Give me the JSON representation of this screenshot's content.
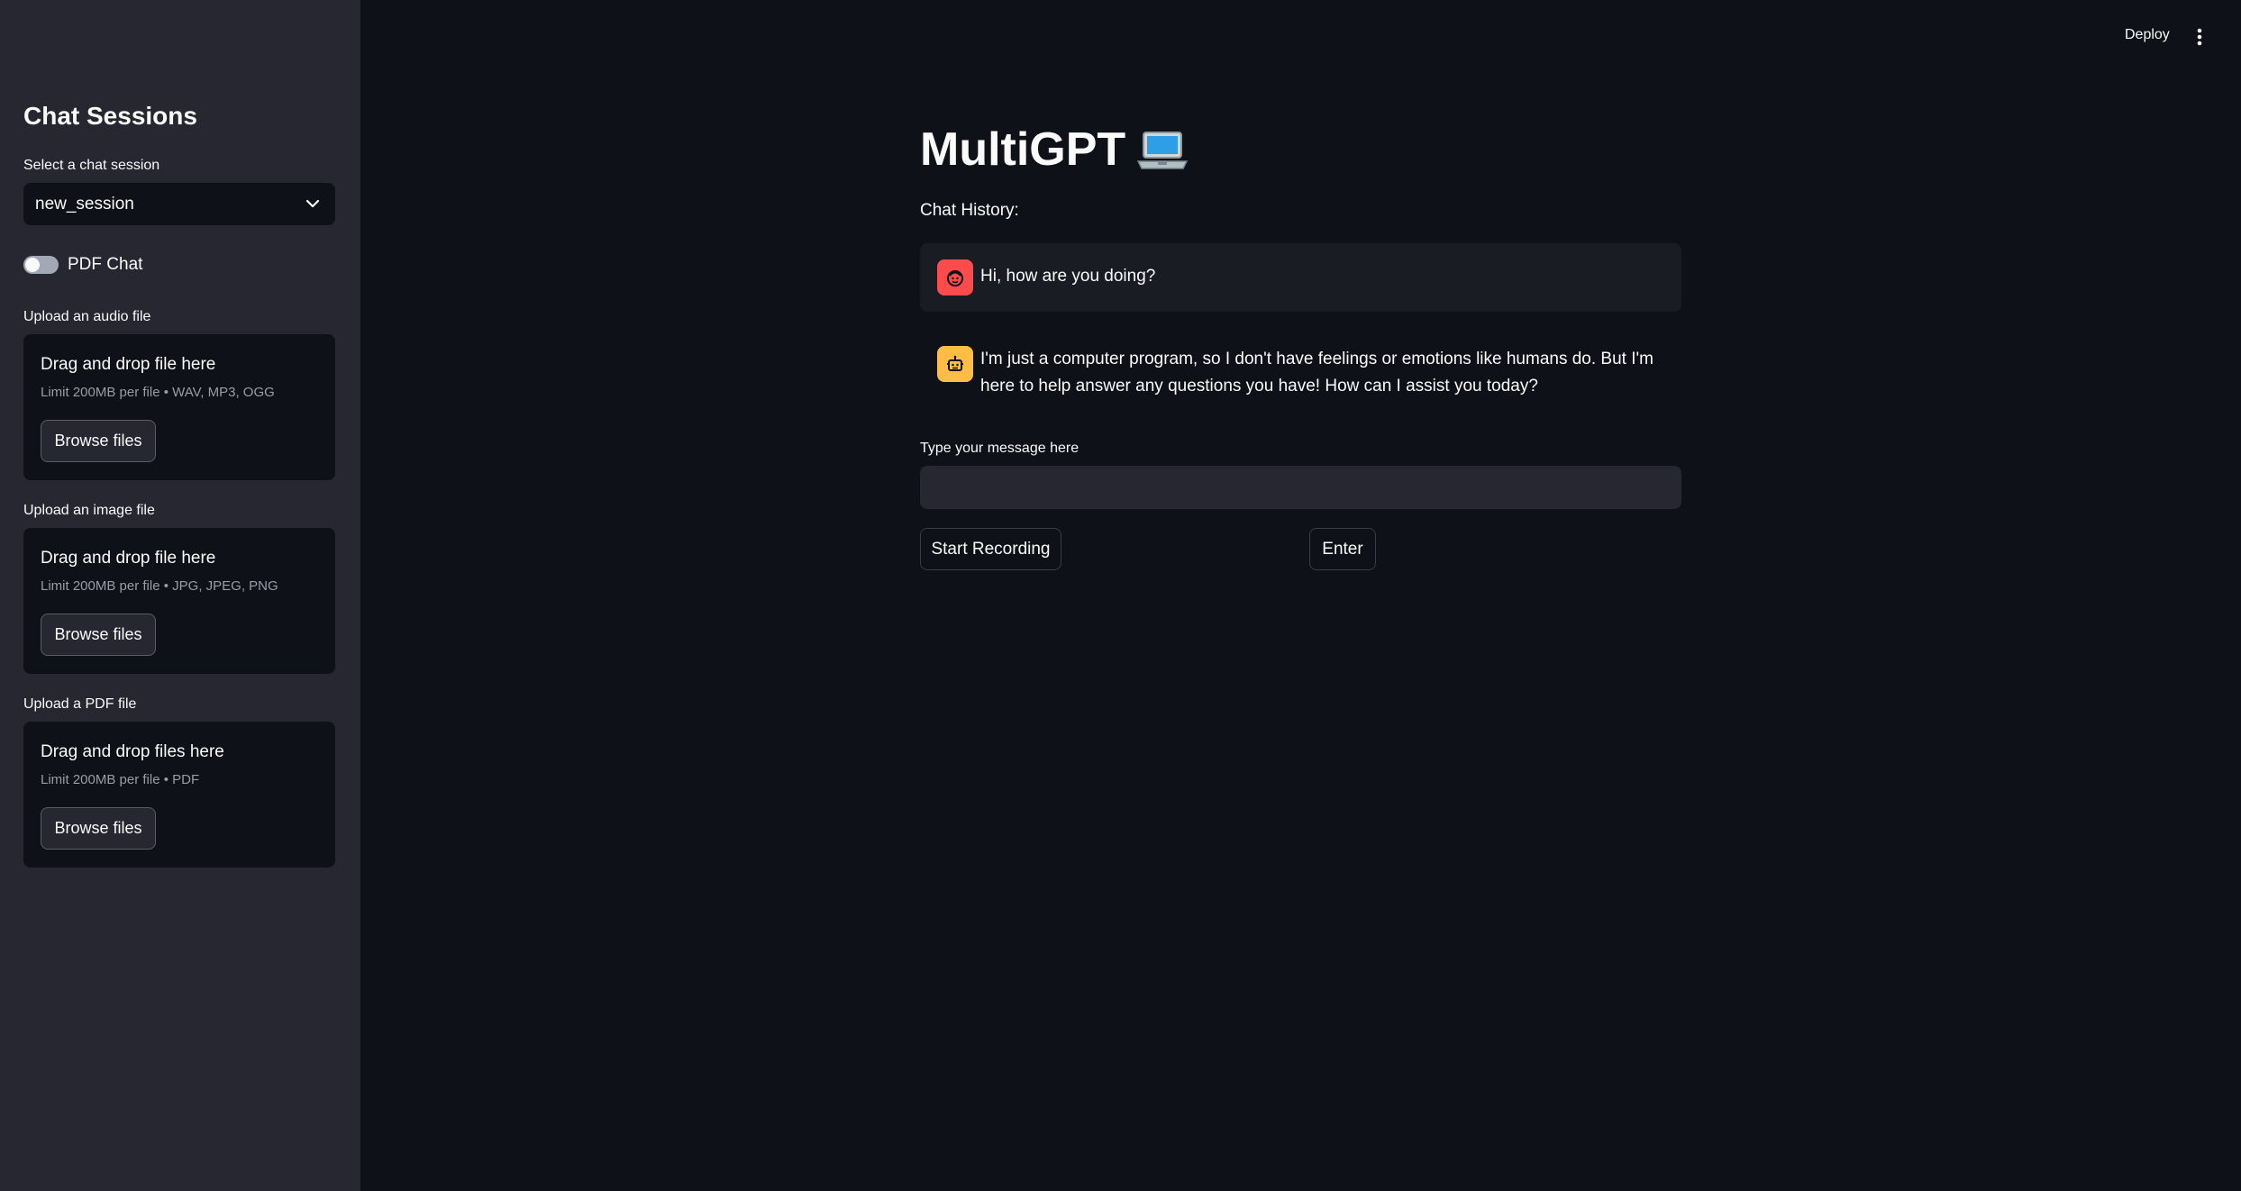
{
  "sidebar": {
    "title": "Chat Sessions",
    "session_select": {
      "label": "Select a chat session",
      "value": "new_session"
    },
    "pdf_toggle": {
      "label": "PDF Chat",
      "checked": false
    },
    "uploaders": [
      {
        "label": "Upload an audio file",
        "drop_text": "Drag and drop file here",
        "limit": "Limit 200MB per file • WAV, MP3, OGG",
        "button": "Browse files"
      },
      {
        "label": "Upload an image file",
        "drop_text": "Drag and drop file here",
        "limit": "Limit 200MB per file • JPG, JPEG, PNG",
        "button": "Browse files"
      },
      {
        "label": "Upload a PDF file",
        "drop_text": "Drag and drop files here",
        "limit": "Limit 200MB per file • PDF",
        "button": "Browse files"
      }
    ]
  },
  "header": {
    "deploy_label": "Deploy",
    "menu_icon": "kebab-menu-icon"
  },
  "main": {
    "title": "MultiGPT",
    "title_icon": "laptop-icon",
    "history_label": "Chat History:",
    "messages": [
      {
        "role": "user",
        "avatar_icon": "user-face-icon",
        "text": "Hi, how are you doing?"
      },
      {
        "role": "assistant",
        "avatar_icon": "robot-icon",
        "text": "I'm just a computer program, so I don't have feelings or emotions like humans do. But I'm here to help answer any questions you have! How can I assist you today?"
      }
    ],
    "input": {
      "label": "Type your message here",
      "value": "",
      "placeholder": ""
    },
    "record_button": "Start Recording",
    "enter_button": "Enter"
  },
  "colors": {
    "background": "#0e1117",
    "sidebar": "#262730",
    "user_avatar": "#ff4b4b",
    "assistant_avatar": "#ffbd45"
  }
}
